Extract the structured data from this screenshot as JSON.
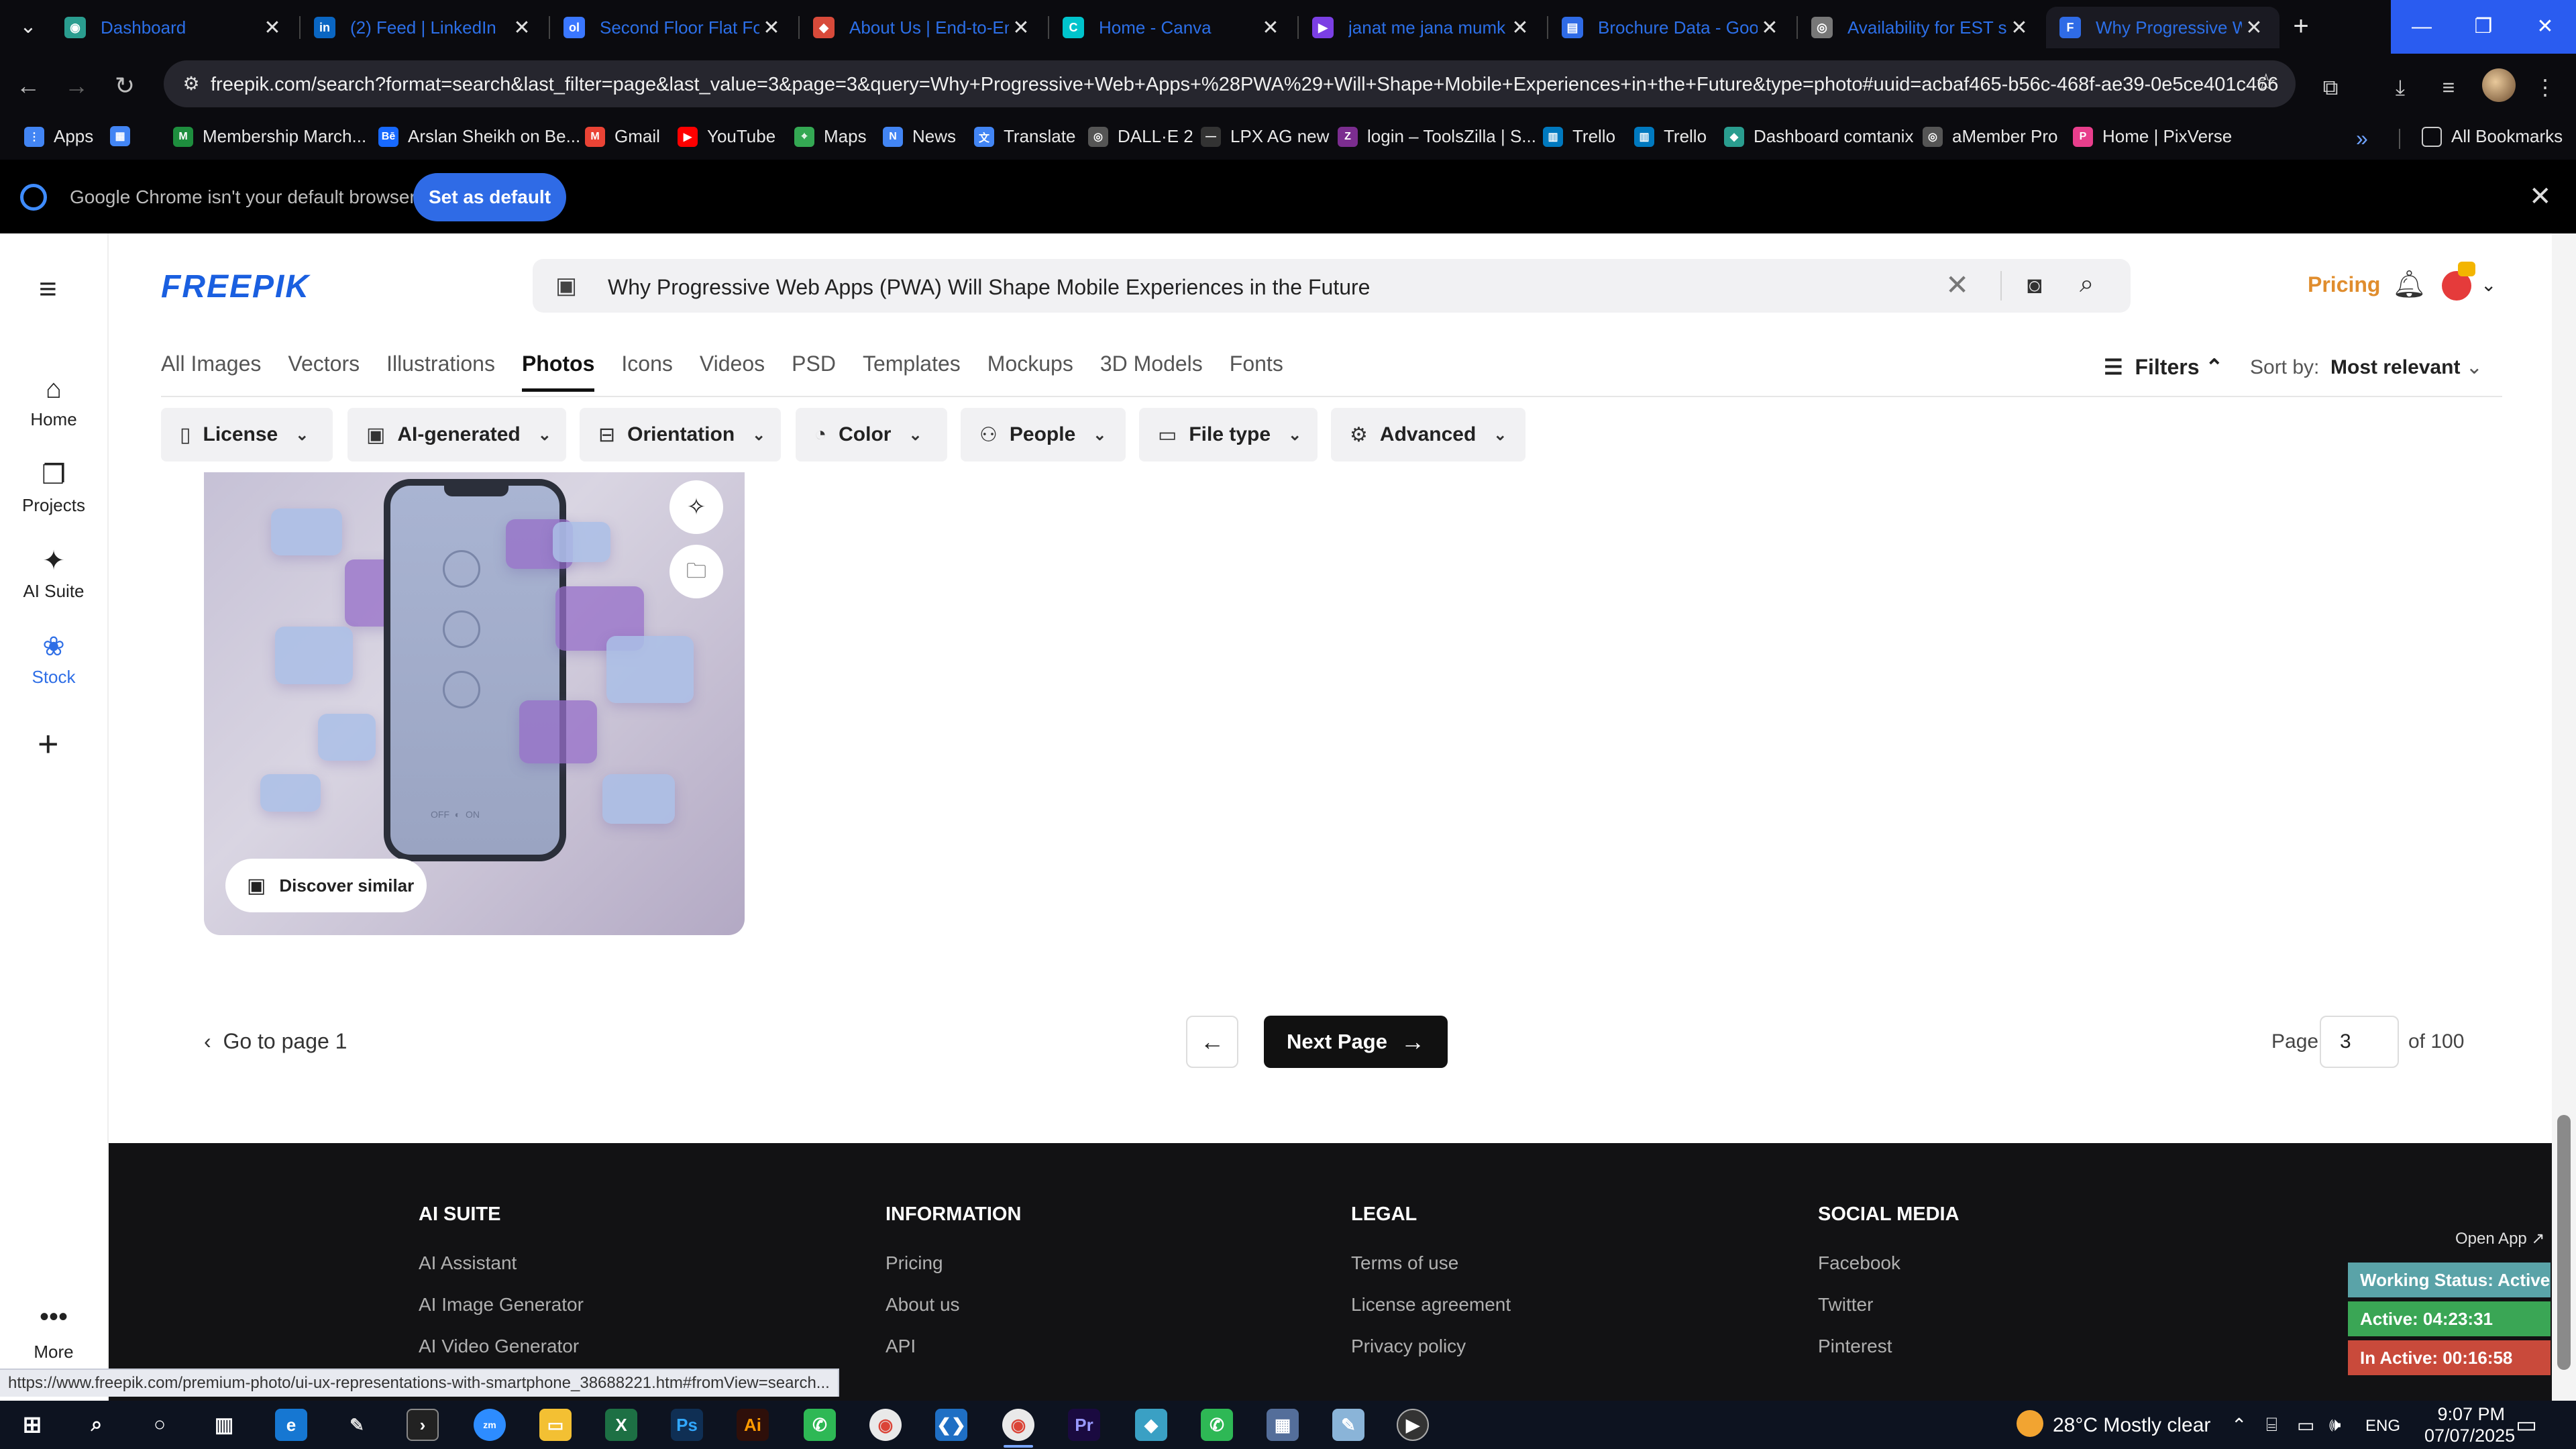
{
  "browser": {
    "tabs": [
      {
        "title": "Dashboard",
        "icon": "globe-icon",
        "color": "#2a9d8f"
      },
      {
        "title": "(2) Feed | LinkedIn",
        "icon": "linkedin-icon",
        "color": "#0a66c2"
      },
      {
        "title": "Second Floor Flat For",
        "icon": "olx-icon",
        "color": "#3a77ff"
      },
      {
        "title": "About Us | End-to-En",
        "icon": "site-icon",
        "color": "#d84a3a"
      },
      {
        "title": "Home - Canva",
        "icon": "canva-icon",
        "color": "#00c4cc"
      },
      {
        "title": "janat me jana mumk",
        "icon": "video-icon",
        "color": "#7b3fe4"
      },
      {
        "title": "Brochure Data - Goo",
        "icon": "sheets-icon",
        "color": "#2f6be6"
      },
      {
        "title": "Availability for EST sh",
        "icon": "globe-icon",
        "color": "#777777"
      },
      {
        "title": "Why Progressive Web",
        "icon": "doc-icon",
        "color": "#2f6be6"
      }
    ],
    "url": "freepik.com/search?format=search&last_filter=page&last_value=3&page=3&query=Why+Progressive+Web+Apps+%28PWA%29+Will+Shape+Mobile+Experiences+in+the+Future&type=photo#uuid=acbaf465-b56c-468f-ae39-0e5ce401c466",
    "bookmarks": [
      {
        "label": "Apps",
        "color": "#4285f4"
      },
      {
        "label": "",
        "color": "#4285f4"
      },
      {
        "label": "Membership March...",
        "color": "#1e8e3e"
      },
      {
        "label": "Arslan Sheikh on Be...",
        "color": "#1769ff"
      },
      {
        "label": "Gmail",
        "color": "#ea4335"
      },
      {
        "label": "YouTube",
        "color": "#ff0000"
      },
      {
        "label": "Maps",
        "color": "#34a853"
      },
      {
        "label": "News",
        "color": "#4285f4"
      },
      {
        "label": "Translate",
        "color": "#4285f4"
      },
      {
        "label": "DALL·E 2",
        "color": "#555555"
      },
      {
        "label": "LPX AG new",
        "color": "#333333"
      },
      {
        "label": "login – ToolsZilla | S...",
        "color": "#7b2d8f"
      },
      {
        "label": "Trello",
        "color": "#0079bf"
      },
      {
        "label": "Trello",
        "color": "#0079bf"
      },
      {
        "label": "Dashboard comtanix",
        "color": "#2a9d8f"
      },
      {
        "label": "aMember Pro",
        "color": "#555555"
      },
      {
        "label": "Home | PixVerse",
        "color": "#e83e8c"
      }
    ],
    "all_bookmarks": "All Bookmarks",
    "infobar_text": "Google Chrome isn't your default browser",
    "infobar_button": "Set as default"
  },
  "rail": {
    "items": [
      {
        "label": "Home",
        "icon": "home-icon"
      },
      {
        "label": "Projects",
        "icon": "projects-icon"
      },
      {
        "label": "AI Suite",
        "icon": "ai-suite-icon"
      },
      {
        "label": "Stock",
        "icon": "stock-icon"
      }
    ],
    "more": "More"
  },
  "header": {
    "logo": "FREEPIK",
    "search_query": "Why Progressive Web Apps (PWA) Will Shape Mobile Experiences in the Future",
    "pricing": "Pricing"
  },
  "categories": [
    "All Images",
    "Vectors",
    "Illustrations",
    "Photos",
    "Icons",
    "Videos",
    "PSD",
    "Templates",
    "Mockups",
    "3D Models",
    "Fonts"
  ],
  "active_category": "Photos",
  "filters_label": "Filters",
  "sort": {
    "label": "Sort by:",
    "value": "Most relevant"
  },
  "chips": [
    {
      "label": "License",
      "icon": "license-icon"
    },
    {
      "label": "AI-generated",
      "icon": "ai-generated-icon"
    },
    {
      "label": "Orientation",
      "icon": "orientation-icon"
    },
    {
      "label": "Color",
      "icon": "palette-icon"
    },
    {
      "label": "People",
      "icon": "people-icon"
    },
    {
      "label": "File type",
      "icon": "file-icon"
    },
    {
      "label": "Advanced",
      "icon": "gear-icon"
    }
  ],
  "card": {
    "discover_label": "Discover similar",
    "phone_labels": {
      "off": "OFF",
      "on": "ON"
    }
  },
  "pagination": {
    "goto_first": "Go to page 1",
    "next": "Next Page",
    "page_label": "Page",
    "page_value": "3",
    "of_label": "of 100"
  },
  "footer": {
    "columns": [
      {
        "heading": "AI SUITE",
        "links": [
          "AI Assistant",
          "AI Image Generator",
          "AI Video Generator"
        ]
      },
      {
        "heading": "INFORMATION",
        "links": [
          "Pricing",
          "About us",
          "API"
        ]
      },
      {
        "heading": "LEGAL",
        "links": [
          "Terms of use",
          "License agreement",
          "Privacy policy"
        ]
      },
      {
        "heading": "SOCIAL MEDIA",
        "links": [
          "Facebook",
          "Twitter",
          "Pinterest"
        ]
      }
    ]
  },
  "tracker": {
    "open_app": "Open App ↗",
    "working_status": "Working Status: Active",
    "active": "Active: 04:23:31",
    "inactive": "In Active: 00:16:58",
    "colors": {
      "working": "#5aa3a8",
      "active": "#3aa655",
      "inactive": "#c94a3b"
    }
  },
  "status_url": "https://www.freepik.com/premium-photo/ui-ux-representations-with-smartphone_38688221.htm#fromView=search...",
  "taskbar": {
    "weather": "28°C  Mostly clear",
    "language": "ENG",
    "time": "9:07 PM",
    "date": "07/07/2025"
  }
}
